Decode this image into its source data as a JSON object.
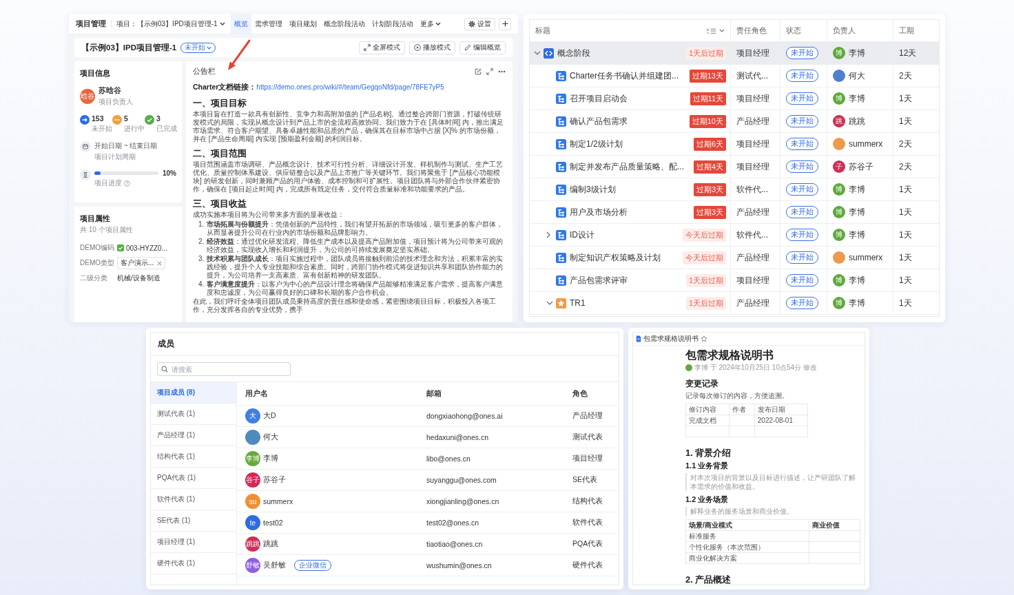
{
  "overview_panel": {
    "nav": {
      "module_title": "项目管理",
      "project_selector": "项目：【示例03】IPD项目管理-1",
      "tabs": [
        {
          "label": "概览",
          "selected": true,
          "kind": "page"
        },
        {
          "label": "需求管理",
          "selected": false,
          "kind": "page"
        },
        {
          "label": "项目规划",
          "selected": false,
          "kind": "page"
        },
        {
          "label": "概念阶段活动",
          "selected": false,
          "kind": "page"
        },
        {
          "label": "计划阶段活动",
          "selected": false,
          "kind": "page"
        },
        {
          "label": "更多",
          "selected": false,
          "kind": "menu"
        }
      ],
      "settings_button": "设置"
    },
    "title_bar": {
      "project_name": "【示例03】IPD项目管理-1",
      "status": "未开始",
      "buttons": [
        {
          "label": "全屏模式",
          "kind": "fullscreen"
        },
        {
          "label": "播放模式",
          "kind": "play"
        },
        {
          "label": "编辑概览",
          "kind": "edit"
        }
      ]
    },
    "info_card": {
      "title": "项目信息",
      "owner": {
        "avatar_text": "晗谷",
        "name": "苏晗谷",
        "role": "项目负责人"
      },
      "stats": [
        {
          "count": "153",
          "label": "未开始",
          "kind": "todo",
          "color": "#2f6be5"
        },
        {
          "count": "5",
          "label": "进行中",
          "kind": "doing",
          "color": "#f0a040"
        },
        {
          "count": "3",
          "label": "已完成",
          "kind": "done",
          "color": "#5aab4a"
        }
      ],
      "schedule": {
        "range": "开始日期 ~ 结束日期",
        "caption": "项目计划周期"
      },
      "progress": {
        "level": 0.1,
        "reading": "10%",
        "caption": "项目进度"
      }
    },
    "properties_card": {
      "title": "项目属性",
      "subtitle": "共 10 个项目属性",
      "fields": [
        {
          "label": "DEMO编码",
          "value": "003-HYZZ0...",
          "kind": "code"
        },
        {
          "label": "DEMO类型",
          "value": "客户演示...",
          "kind": "tag"
        },
        {
          "label": "二级分类",
          "value": "机械/设备制造",
          "kind": "text"
        }
      ]
    },
    "bulletin": {
      "title": "公告栏",
      "link_label": "Charter文档链接：",
      "link_url": "https://demo.ones.pro/wiki/#/team/GegqoNfd/page/78FE7yP5",
      "sections": [
        {
          "heading": "一、项目目标",
          "blocks": [
            {
              "kind": "paragraph",
              "text": "本项目旨在打造一款具有创新性、竞争力和高附加值的 [产品名称]。通过整合跨部门资源，打破传统研发模式的局限，实现从概念设计到产品上市的全流程高效协同。我们致力于在 [具体时间] 内，推出满足市场需求、符合客户期望、具备卓越性能和品质的产品，确保其在目标市场中占据 [X]% 的市场份额，并在 [产品生命周期] 内实现 [预期盈利金额] 的利润目标。"
            }
          ]
        },
        {
          "heading": "二、项目范围",
          "blocks": [
            {
              "kind": "paragraph",
              "text": "项目范围涵盖市场调研、产品概念设计、技术可行性分析、详细设计开发、样机制作与测试、生产工艺优化、质量控制体系建设、供应链整合以及产品上市推广等关键环节。我们将聚焦于 [产品核心功能模块] 的研发创新，同时兼顾产品的用户体验、成本控制和可扩展性。项目团队将与外部合作伙伴紧密协作，确保在 [项目起止时间] 内，完成所有既定任务，交付符合质量标准和功能要求的产品。"
            }
          ]
        },
        {
          "heading": "三、项目收益",
          "blocks": [
            {
              "kind": "paragraph",
              "text": "成功实施本项目将为公司带来多方面的显著收益："
            },
            {
              "kind": "list_item",
              "number": "1.",
              "text": "**市场拓展与份额提升**：凭借创新的产品特性，我们有望开拓新的市场领域，吸引更多的客户群体，从而显著提升公司在行业内的市场份额和品牌影响力。"
            },
            {
              "kind": "list_item",
              "number": "2.",
              "text": "**经济效益**：通过优化研发流程、降低生产成本以及提高产品附加值，项目预计将为公司带来可观的经济效益，实现收入增长和利润提升，为公司的可持续发展奠定坚实基础。"
            },
            {
              "kind": "list_item",
              "number": "3.",
              "text": "**技术积累与团队成长**：项目实施过程中，团队成员将接触到前沿的技术理念和方法，积累丰富的实践经验，提升个人专业技能和综合素质。同时，跨部门协作模式将促进知识共享和团队协作能力的提升，为公司培养一支高素质、富有创新精神的研发团队。"
            },
            {
              "kind": "list_item",
              "number": "4.",
              "text": "**客户满意度提升**：以客户为中心的产品设计理念将确保产品能够精准满足客户需求，提高客户满意度和忠诚度，为公司赢得良好的口碑和长期的客户合作机会。"
            },
            {
              "kind": "paragraph",
              "text": "在此，我们呼吁全体项目团队成员秉持高度的责任感和使命感，紧密围绕项目目标，积极投入各项工作，充分发挥各自的专业优势，携手"
            }
          ]
        }
      ]
    }
  },
  "task_table": {
    "columns": [
      "标题",
      "责任角色",
      "状态",
      "负责人",
      "工期"
    ],
    "rows": [
      {
        "title": "概念阶段",
        "kind": "phase",
        "expanded": true,
        "selected": true,
        "due": {
          "text": "1天后过期",
          "kind": "upcoming"
        },
        "role": "项目经理",
        "status": "未开始",
        "assignee": {
          "avatar_text": "博",
          "color": "#5fa83c",
          "name": "李博"
        },
        "duration": "12天",
        "children": [
          {
            "title": "Charter任务书确认并组建团...",
            "kind": "task",
            "selected": false,
            "due": {
              "text": "过期13天",
              "kind": "overdue"
            },
            "role": "测试代...",
            "status": "未开始",
            "assignee": {
              "color": "#4f7fcf",
              "name": "何大"
            },
            "duration": "2天"
          },
          {
            "title": "召开项目启动会",
            "kind": "task",
            "selected": false,
            "due": {
              "text": "过期11天",
              "kind": "overdue"
            },
            "role": "项目经理",
            "status": "未开始",
            "assignee": {
              "avatar_text": "博",
              "color": "#5fa83c",
              "name": "李博"
            },
            "duration": "1天"
          },
          {
            "title": "确认产品包需求",
            "kind": "task",
            "selected": false,
            "due": {
              "text": "过期10天",
              "kind": "overdue"
            },
            "role": "产品经理",
            "status": "未开始",
            "assignee": {
              "avatar_text": "跳",
              "color": "#c9304f",
              "name": "跳跳"
            },
            "duration": "1天"
          },
          {
            "title": "制定1/2级计划",
            "kind": "task",
            "selected": false,
            "due": {
              "text": "过期6天",
              "kind": "overdue"
            },
            "role": "项目经理",
            "status": "未开始",
            "assignee": {
              "color": "#eb9a4e",
              "name": "summerx"
            },
            "duration": "2天"
          },
          {
            "title": "制定并发布产品质量策略、配...",
            "kind": "task",
            "selected": false,
            "due": {
              "text": "过期4天",
              "kind": "overdue"
            },
            "role": "项目经理",
            "status": "未开始",
            "assignee": {
              "avatar_text": "子",
              "color": "#cf2f55",
              "name": "苏谷子"
            },
            "duration": "2天"
          },
          {
            "title": "编制3级计划",
            "kind": "task",
            "selected": false,
            "due": {
              "text": "过期3天",
              "kind": "overdue"
            },
            "role": "软件代...",
            "status": "未开始",
            "assignee": {
              "avatar_text": "博",
              "color": "#5fa83c",
              "name": "李博"
            },
            "duration": "1天"
          },
          {
            "title": "用户及市场分析",
            "kind": "task",
            "selected": false,
            "due": {
              "text": "过期3天",
              "kind": "overdue"
            },
            "role": "产品经理",
            "status": "未开始",
            "assignee": {
              "avatar_text": "博",
              "color": "#5fa83c",
              "name": "李博"
            },
            "duration": "1天"
          },
          {
            "title": "ID设计",
            "kind": "task",
            "expanded": false,
            "selected": false,
            "due": {
              "text": "今天后过期",
              "kind": "upcoming"
            },
            "role": "软件代...",
            "status": "未开始",
            "assignee": {
              "avatar_text": "博",
              "color": "#5fa83c",
              "name": "李博"
            },
            "duration": "1天"
          },
          {
            "title": "制定知识产权策略及计划",
            "kind": "task",
            "selected": false,
            "due": {
              "text": "今天后过期",
              "kind": "upcoming"
            },
            "role": "产品经理",
            "status": "未开始",
            "assignee": {
              "color": "#eb9a4e",
              "name": "summerx"
            },
            "duration": "1天"
          },
          {
            "title": "产品包需求评审",
            "kind": "task",
            "selected": false,
            "due": {
              "text": "1天后过期",
              "kind": "upcoming"
            },
            "role": "项目经理",
            "status": "未开始",
            "assignee": {
              "avatar_text": "博",
              "color": "#5fa83c",
              "name": "李博"
            },
            "duration": "1天"
          },
          {
            "title": "TR1",
            "kind": "milestone",
            "expanded": true,
            "selected": false,
            "due": {
              "text": "1天后过期",
              "kind": "upcoming"
            },
            "role": "产品经理",
            "status": "未开始",
            "assignee": {
              "avatar_text": "博",
              "color": "#5fa83c",
              "name": "李博"
            },
            "duration": "1天"
          }
        ]
      }
    ]
  },
  "members_panel": {
    "title": "成员",
    "search": {
      "placeholder": "请搜索"
    },
    "groups": [
      {
        "label": "项目成员 (8)",
        "selected": true
      },
      {
        "label": "测试代表 (1)",
        "selected": false
      },
      {
        "label": "产品经理 (1)",
        "selected": false
      },
      {
        "label": "结构代表 (1)",
        "selected": false
      },
      {
        "label": "PQA代表 (1)",
        "selected": false
      },
      {
        "label": "软件代表 (1)",
        "selected": false
      },
      {
        "label": "SE代表 (1)",
        "selected": false
      },
      {
        "label": "项目经理 (1)",
        "selected": false
      },
      {
        "label": "硬件代表 (1)",
        "selected": false
      }
    ],
    "columns": [
      "用户名",
      "邮箱",
      "角色"
    ],
    "rows": [
      {
        "avatar_text": "大",
        "color": "#3f7fe3",
        "name": "大D",
        "email": "dongxiaohong@ones.ai",
        "role": "产品经理"
      },
      {
        "color": "#4d8bbd",
        "name": "何大",
        "email": "hedaxuni@ones.cn",
        "role": "测试代表"
      },
      {
        "avatar_text": "李博",
        "color": "#68a93c",
        "name": "李博",
        "email": "libo@ones.cn",
        "role": "项目经理"
      },
      {
        "avatar_text": "谷子",
        "color": "#d5285a",
        "name": "苏谷子",
        "email": "suyanggu@ones.com",
        "role": "SE代表"
      },
      {
        "avatar_text": "su",
        "color": "#f0902c",
        "name": "summerx",
        "email": "xiongjianling@ones.cn",
        "role": "结构代表"
      },
      {
        "avatar_text": "te",
        "color": "#2f6ce0",
        "name": "test02",
        "email": "test02@ones.cn",
        "role": "软件代表"
      },
      {
        "avatar_text": "跳跳",
        "color": "#d42b57",
        "name": "跳跳",
        "email": "tiaotiao@ones.cn",
        "role": "PQA代表"
      },
      {
        "avatar_text": "舒敏",
        "color": "#8d5fe0",
        "name": "吴舒敏",
        "tag": "企业微信",
        "email": "wushumin@ones.cn",
        "role": "硬件代表"
      }
    ]
  },
  "doc_panel": {
    "tab_title": "包需求规格说明书",
    "title": "包需求规格说明书",
    "meta": "李博 于 2024年10月25日 10点54分 修改",
    "blocks": [
      {
        "kind": "h2",
        "text": "变更记录"
      },
      {
        "kind": "p",
        "text": "记录每次修订的内容，方便追溯。"
      },
      {
        "kind": "table",
        "rows": [
          [
            "修订内容",
            "作者",
            "发布日期"
          ],
          [
            "完成文档",
            null,
            "2022-08-01"
          ],
          [
            null,
            null,
            null
          ]
        ]
      },
      {
        "kind": "h1",
        "text": "1. 背景介绍"
      },
      {
        "kind": "h3",
        "text": "1.1 业务背景"
      },
      {
        "kind": "quote",
        "text": "对本次项目的背景以及目标进行描述，让产研团队了解本需求的价值和收益。"
      },
      {
        "kind": "h3",
        "text": "1.2 业务场景"
      },
      {
        "kind": "quote",
        "text": "解释业务的服务场景和商业价值。"
      },
      {
        "kind": "table",
        "header": [
          "场景/商业模式",
          "商业价值"
        ],
        "rows": [
          [
            "标准服务",
            null
          ],
          [
            "个性化服务（本次范围）",
            null
          ],
          [
            "商业化解决方案",
            null
          ]
        ]
      },
      {
        "kind": "h1",
        "text": "2. 产品概述"
      }
    ]
  }
}
